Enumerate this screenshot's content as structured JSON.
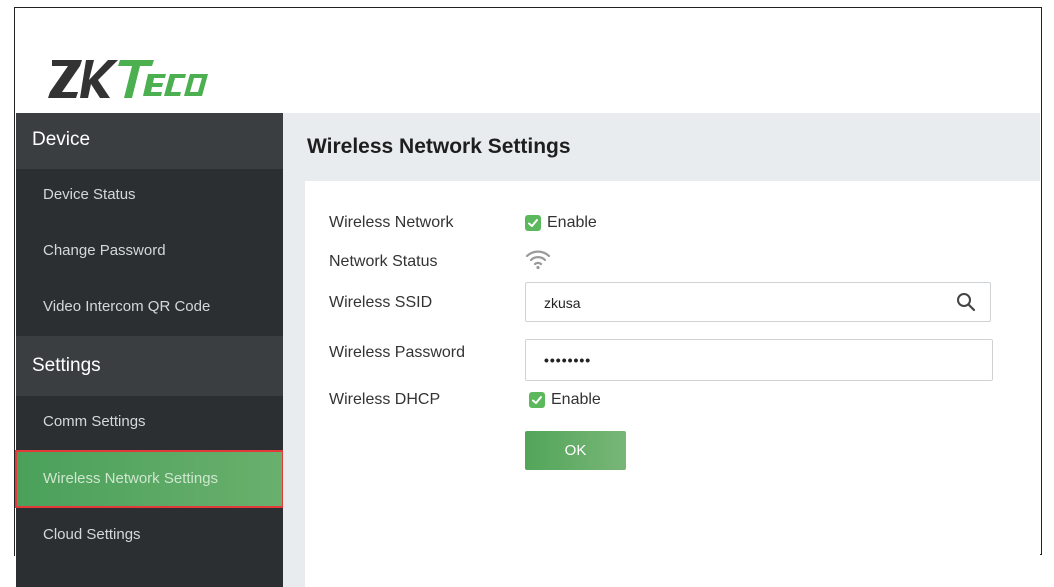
{
  "brand": {
    "logo_text": "ZKTeco",
    "accent": "#5cb85c",
    "sidebar_bg": "#2b2f32"
  },
  "sidebar": {
    "sections": [
      {
        "title": "Device",
        "items": [
          "Device Status",
          "Change Password",
          "Video Intercom QR Code"
        ]
      },
      {
        "title": "Settings",
        "items": [
          "Comm Settings",
          "Wireless Network Settings",
          "Cloud Settings"
        ]
      }
    ],
    "active_item": "Wireless Network Settings"
  },
  "main": {
    "title": "Wireless Network Settings",
    "form": {
      "wireless_network": {
        "label": "Wireless Network",
        "checkbox_label": "Enable",
        "checked": true
      },
      "network_status": {
        "label": "Network Status",
        "icon": "wifi-icon"
      },
      "ssid": {
        "label": "Wireless SSID",
        "value": "zkusa",
        "icon": "search-icon"
      },
      "password": {
        "label": "Wireless Password",
        "value": "••••••••"
      },
      "dhcp": {
        "label": "Wireless DHCP",
        "checkbox_label": "Enable",
        "checked": true
      },
      "ok_label": "OK"
    }
  }
}
